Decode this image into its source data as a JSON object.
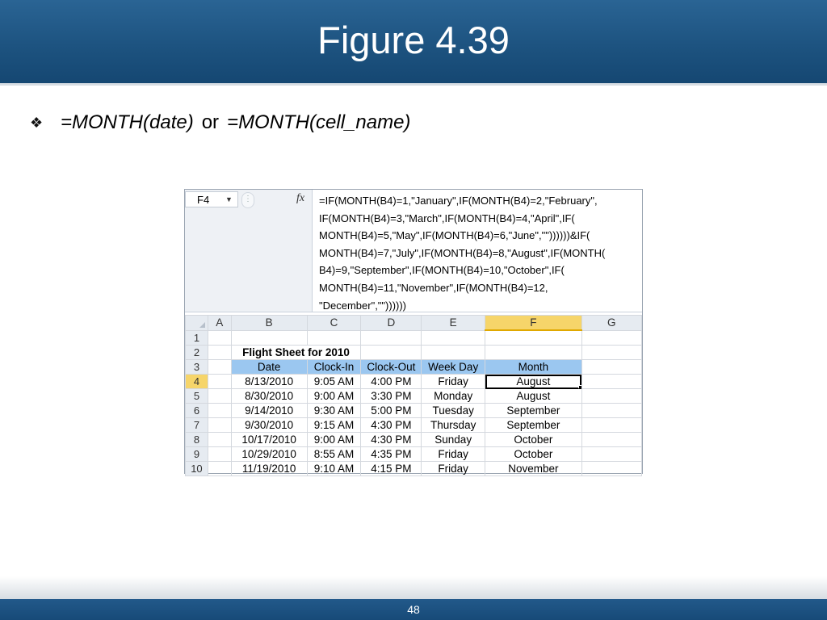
{
  "slide": {
    "title": "Figure 4.39",
    "page_number": "48"
  },
  "bullet": {
    "symbol": "❖",
    "part1": "=MONTH(date)",
    "connector": "or",
    "part2": "=MONTH(cell_name)"
  },
  "excel": {
    "name_box": "F4",
    "fx_label": "fx",
    "formula_lines": [
      "=IF(MONTH(B4)=1,\"January\",IF(MONTH(B4)=2,\"February\",",
      "IF(MONTH(B4)=3,\"March\",IF(MONTH(B4)=4,\"April\",IF(",
      "MONTH(B4)=5,\"May\",IF(MONTH(B4)=6,\"June\",\"\"))))))&IF(",
      "MONTH(B4)=7,\"July\",IF(MONTH(B4)=8,\"August\",IF(MONTH(",
      "B4)=9,\"September\",IF(MONTH(B4)=10,\"October\",IF(",
      "MONTH(B4)=11,\"November\",IF(MONTH(B4)=12,",
      "\"December\",\"\"))))))"
    ],
    "column_headers": [
      "A",
      "B",
      "C",
      "D",
      "E",
      "F",
      "G"
    ],
    "row_numbers": [
      "1",
      "2",
      "3",
      "4",
      "5",
      "6",
      "7",
      "8",
      "9",
      "10"
    ],
    "sheet_title": "Flight Sheet for 2010",
    "table_headers": [
      "Date",
      "Clock-In",
      "Clock-Out",
      "Week Day",
      "Month"
    ],
    "rows": [
      [
        "8/13/2010",
        "9:05 AM",
        "4:00 PM",
        "Friday",
        "August"
      ],
      [
        "8/30/2010",
        "9:00 AM",
        "3:30 PM",
        "Monday",
        "August"
      ],
      [
        "9/14/2010",
        "9:30 AM",
        "5:00 PM",
        "Tuesday",
        "September"
      ],
      [
        "9/30/2010",
        "9:15 AM",
        "4:30 PM",
        "Thursday",
        "September"
      ],
      [
        "10/17/2010",
        "9:00 AM",
        "4:30 PM",
        "Sunday",
        "October"
      ],
      [
        "10/29/2010",
        "8:55 AM",
        "4:35 PM",
        "Friday",
        "October"
      ],
      [
        "11/19/2010",
        "9:10 AM",
        "4:15 PM",
        "Friday",
        "November"
      ]
    ],
    "colors": {
      "header_fill": "#9bc7f0",
      "selected_header": "#f6d56a"
    }
  }
}
